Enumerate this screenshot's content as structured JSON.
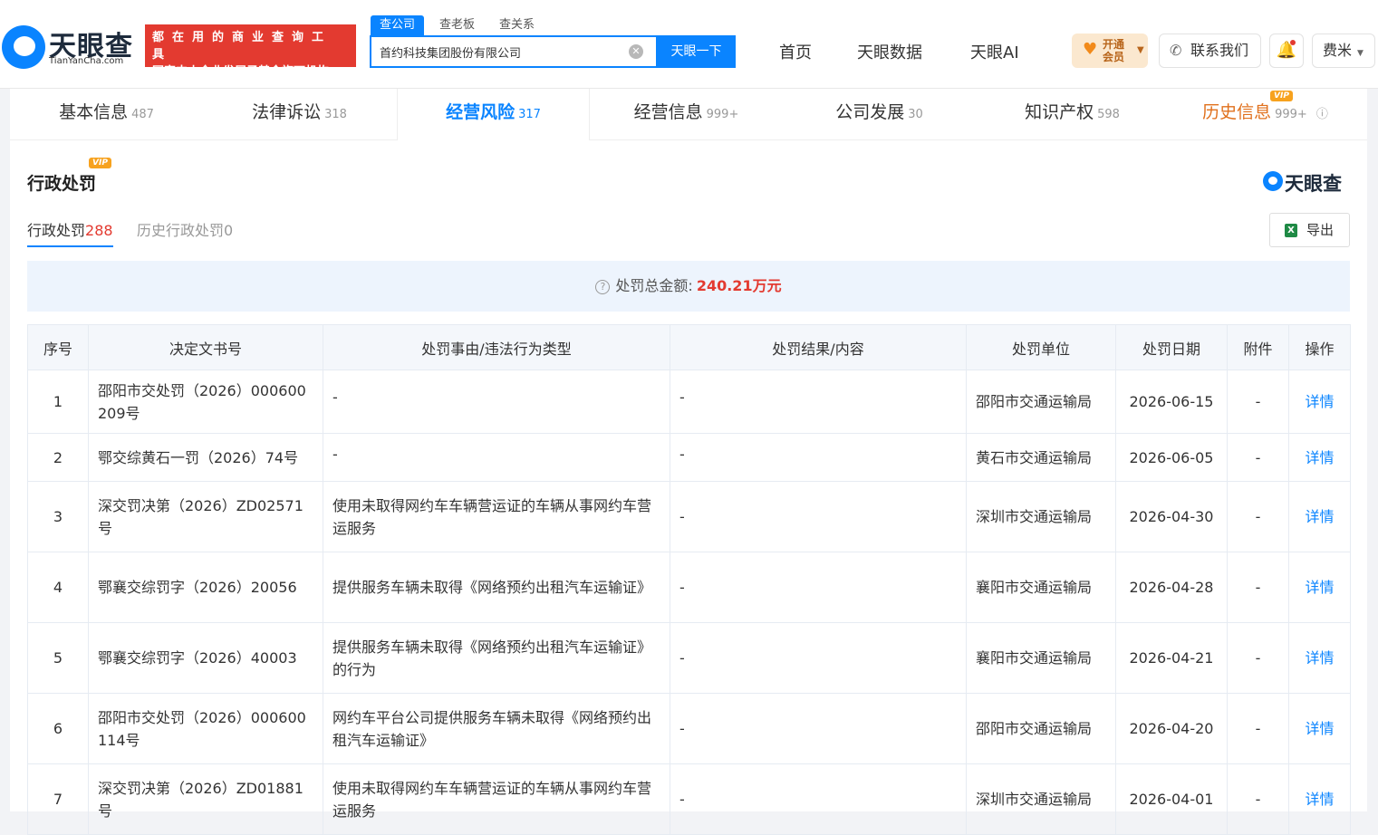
{
  "logo": {
    "name": "天眼查",
    "domain": "TianYanCha.com"
  },
  "banner": {
    "line1": "都在用的商业查询工具",
    "line2": "国家中小企业发展子基金旗下机构"
  },
  "search": {
    "tabs": [
      "查公司",
      "查老板",
      "查关系"
    ],
    "value": "首约科技集团股份有限公司",
    "button": "天眼一下"
  },
  "nav": {
    "items": [
      "首页",
      "天眼数据",
      "天眼AI"
    ]
  },
  "vip_button": {
    "line1": "开通",
    "line2": "会员"
  },
  "contact": "联系我们",
  "user": "费米",
  "main_tabs": [
    {
      "label": "基本信息",
      "count": "487"
    },
    {
      "label": "法律诉讼",
      "count": "318"
    },
    {
      "label": "经营风险",
      "count": "317"
    },
    {
      "label": "经营信息",
      "count": "999+"
    },
    {
      "label": "公司发展",
      "count": "30"
    },
    {
      "label": "知识产权",
      "count": "598"
    },
    {
      "label": "历史信息",
      "count": "999+"
    }
  ],
  "vip_label": "VIP",
  "section": {
    "title": "行政处罚",
    "brand": "天眼查"
  },
  "subtabs": [
    {
      "label": "行政处罚",
      "count": "288"
    },
    {
      "label": "历史行政处罚",
      "count": "0"
    }
  ],
  "export_label": "导出",
  "summary": {
    "label": "处罚总金额:",
    "amount": "240.21万元"
  },
  "table": {
    "headers": [
      "序号",
      "决定文书号",
      "处罚事由/违法行为类型",
      "处罚结果/内容",
      "处罚单位",
      "处罚日期",
      "附件",
      "操作"
    ],
    "rows": [
      {
        "no": "1",
        "doc": "邵阳市交处罚（2026）000600209号",
        "reason": "-",
        "result": "-",
        "unit": "邵阳市交通运输局",
        "date": "2026-06-15",
        "attach": "-",
        "op": "详情"
      },
      {
        "no": "2",
        "doc": "鄂交综黄石一罚（2026）74号",
        "reason": "-",
        "result": "-",
        "unit": "黄石市交通运输局",
        "date": "2026-06-05",
        "attach": "-",
        "op": "详情"
      },
      {
        "no": "3",
        "doc": "深交罚决第（2026）ZD02571号",
        "reason": "使用未取得网约车车辆营运证的车辆从事网约车营运服务",
        "result": "-",
        "unit": "深圳市交通运输局",
        "date": "2026-04-30",
        "attach": "-",
        "op": "详情"
      },
      {
        "no": "4",
        "doc": "鄂襄交综罚字（2026）20056",
        "reason": "提供服务车辆未取得《网络预约出租汽车运输证》",
        "result": "-",
        "unit": "襄阳市交通运输局",
        "date": "2026-04-28",
        "attach": "-",
        "op": "详情"
      },
      {
        "no": "5",
        "doc": "鄂襄交综罚字（2026）40003",
        "reason": "提供服务车辆未取得《网络预约出租汽车运输证》的行为",
        "result": "-",
        "unit": "襄阳市交通运输局",
        "date": "2026-04-21",
        "attach": "-",
        "op": "详情"
      },
      {
        "no": "6",
        "doc": "邵阳市交处罚（2026）000600114号",
        "reason": "网约车平台公司提供服务车辆未取得《网络预约出租汽车运输证》",
        "result": "-",
        "unit": "邵阳市交通运输局",
        "date": "2026-04-20",
        "attach": "-",
        "op": "详情"
      },
      {
        "no": "7",
        "doc": "深交罚决第（2026）ZD01881号",
        "reason": "使用未取得网约车车辆营运证的车辆从事网约车营运服务",
        "result": "-",
        "unit": "深圳市交通运输局",
        "date": "2026-04-01",
        "attach": "-",
        "op": "详情"
      }
    ]
  }
}
